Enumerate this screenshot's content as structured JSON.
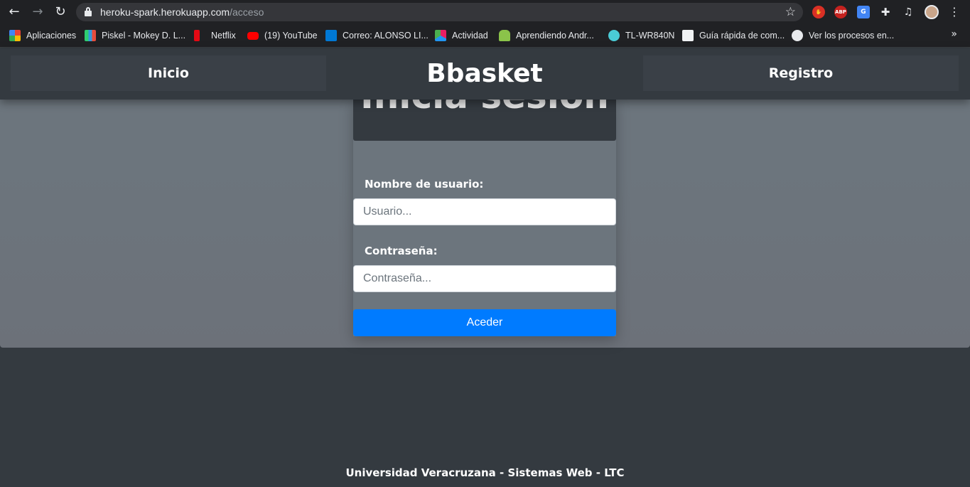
{
  "browser": {
    "url_host": "heroku-spark.herokuapp.com",
    "url_path": "/acceso",
    "extensions": [
      {
        "name": "stop-extension-icon",
        "color": "#d93025",
        "text": ""
      },
      {
        "name": "adblock-plus-icon",
        "color": "#c5221f",
        "text": "ABP"
      },
      {
        "name": "google-translate-icon",
        "color": "#4285f4",
        "text": "G"
      }
    ]
  },
  "bookmarks": [
    {
      "label": "Aplicaciones",
      "icon": "apps-grid-icon"
    },
    {
      "label": "Piskel - Mokey D. L...",
      "icon": "piskel-icon"
    },
    {
      "label": "Netflix",
      "icon": "netflix-icon"
    },
    {
      "label": "(19) YouTube",
      "icon": "youtube-icon"
    },
    {
      "label": "Correo: ALONSO LI...",
      "icon": "outlook-icon"
    },
    {
      "label": "Actividad",
      "icon": "actividad-icon"
    },
    {
      "label": "Aprendiendo Andr...",
      "icon": "android-icon"
    },
    {
      "label": "TL-WR840N",
      "icon": "tplink-icon"
    },
    {
      "label": "Guía rápida de com...",
      "icon": "guide-icon"
    },
    {
      "label": "Ver los procesos en...",
      "icon": "globe-icon"
    }
  ],
  "nav": {
    "home": "Inicio",
    "brand": "Bbasket",
    "register": "Registro"
  },
  "login": {
    "title": "Inicia sesion",
    "username_label": "Nombre de usuario:",
    "username_placeholder": "Usuario...",
    "password_label": "Contraseña:",
    "password_placeholder": "Contraseña...",
    "submit_label": "Aceder"
  },
  "footer": {
    "text": "Universidad Veracruzana - Sistemas Web - LTC"
  },
  "colors": {
    "primary": "#007bff",
    "dark": "#343a40",
    "secondary": "#6c757d"
  }
}
